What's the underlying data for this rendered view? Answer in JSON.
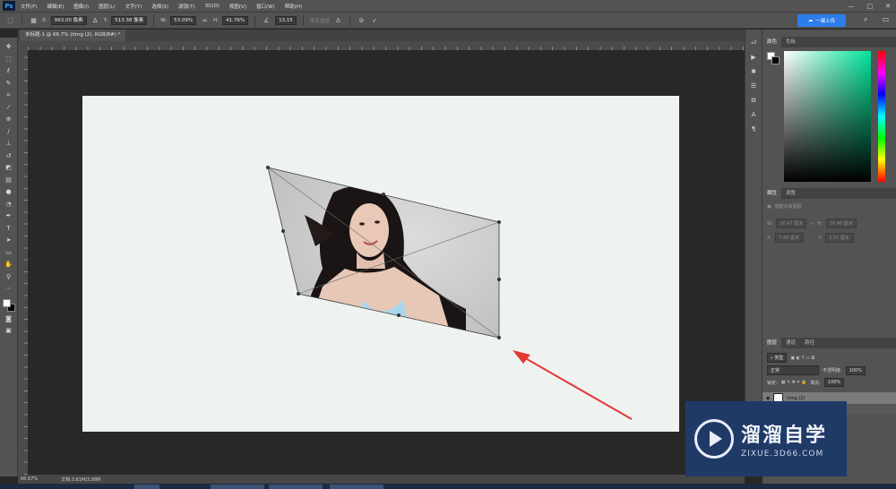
{
  "app": {
    "logo": "Ps"
  },
  "menu": [
    "文件(F)",
    "编辑(E)",
    "图像(I)",
    "图层(L)",
    "文字(Y)",
    "选择(S)",
    "滤镜(T)",
    "3D(D)",
    "视图(V)",
    "窗口(W)",
    "帮助(H)"
  ],
  "window_controls": {
    "minimize": "—",
    "maximize": "□",
    "close": "✕"
  },
  "options": {
    "x_label": "X:",
    "x_value": "993.00 像素",
    "y_label": "Y:",
    "y_value": "513.38 像素",
    "w_label": "W:",
    "w_value": "53.09%",
    "h_label": "H:",
    "h_value": "41.76%",
    "angle_value": "13.15",
    "interp": "渐变插值",
    "upload_label": "一键上传"
  },
  "document": {
    "tab_title": "未标题-1 @ 66.7% (timg (2), RGB/8#) *"
  },
  "status": {
    "zoom": "66.67%",
    "doc_info": "文档:3.81M/3.08M"
  },
  "panels": {
    "color_tabs": [
      "颜色",
      "色板"
    ],
    "properties_tabs": [
      "属性",
      "调整"
    ],
    "properties_title": "智能对象图层",
    "prop_w_label": "W:",
    "prop_h_label": "H:",
    "prop_x_label": "X:",
    "prop_y_label": "Y:",
    "prop_w": "30.47 厘米",
    "prop_h": "20.48 厘米",
    "prop_x": "7.48 厘米",
    "prop_y": "2.51 厘米",
    "layers_tabs": [
      "图层",
      "通道",
      "路径"
    ],
    "kind_label": "类型",
    "blend_mode": "正常",
    "opacity_label": "不透明度:",
    "opacity_value": "100%",
    "lock_label": "锁定:",
    "fill_label": "填充:",
    "fill_value": "100%",
    "layer_name": "timg (2)"
  },
  "watermark": {
    "title": "溜溜自学",
    "url": "ZIXUE.3D66.COM"
  },
  "colors": {
    "accent": "#2b7de9",
    "arrow": "#e53935",
    "canvas": "#eef2f0"
  }
}
